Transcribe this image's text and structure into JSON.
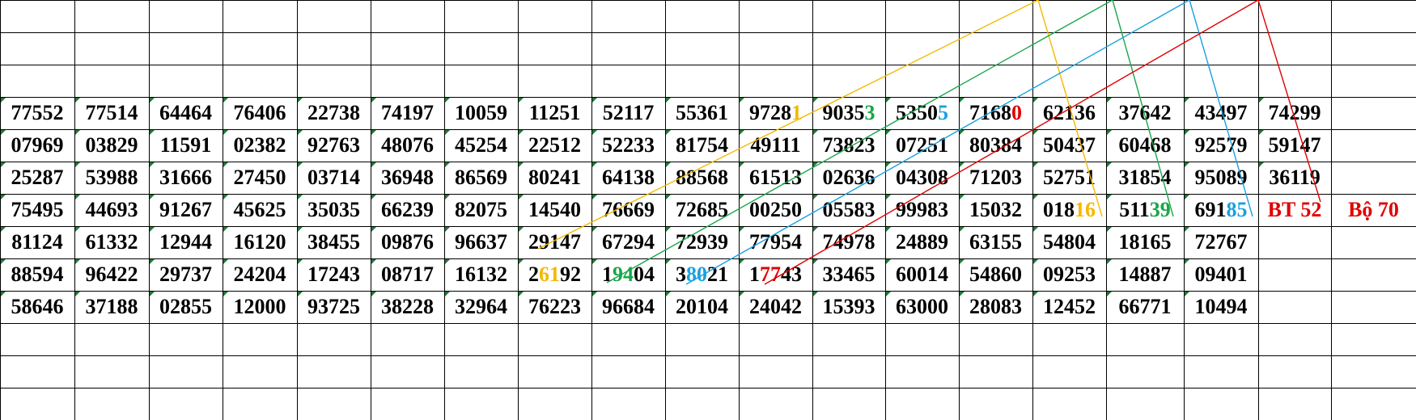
{
  "colors": {
    "gold": "#f5b800",
    "green": "#1aa64a",
    "blue": "#1aa0e0",
    "red": "#e00000",
    "black": "#000000",
    "grid": "#000000",
    "marker": "#1e7b34"
  },
  "rows": [
    [
      {
        "t": "77552"
      },
      {
        "t": "77514"
      },
      {
        "t": "64464"
      },
      {
        "t": "76406"
      },
      {
        "t": "22738"
      },
      {
        "t": "74197"
      },
      {
        "t": "10059"
      },
      {
        "t": "11251"
      },
      {
        "t": "52117"
      },
      {
        "t": "55361"
      },
      {
        "p": [
          {
            "t": "9728"
          },
          {
            "t": "1",
            "c": "gold"
          }
        ]
      },
      {
        "p": [
          {
            "t": "9035"
          },
          {
            "t": "3",
            "c": "green"
          }
        ]
      },
      {
        "p": [
          {
            "t": "5350"
          },
          {
            "t": "5",
            "c": "blue"
          }
        ]
      },
      {
        "p": [
          {
            "t": "7168"
          },
          {
            "t": "0",
            "c": "red"
          }
        ]
      },
      {
        "t": "62136"
      },
      {
        "t": "37642"
      },
      {
        "t": "43497"
      },
      {
        "t": "74299"
      }
    ],
    [
      {
        "t": "07969"
      },
      {
        "t": "03829"
      },
      {
        "t": "11591"
      },
      {
        "t": "02382"
      },
      {
        "t": "92763"
      },
      {
        "t": "48076"
      },
      {
        "t": "45254"
      },
      {
        "t": "22512"
      },
      {
        "t": "52233"
      },
      {
        "t": "81754"
      },
      {
        "t": "49111"
      },
      {
        "t": "73823"
      },
      {
        "t": "07251"
      },
      {
        "t": "80384"
      },
      {
        "t": "50437"
      },
      {
        "t": "60468"
      },
      {
        "t": "92579"
      },
      {
        "t": "59147"
      }
    ],
    [
      {
        "t": "25287"
      },
      {
        "t": "53988"
      },
      {
        "t": "31666"
      },
      {
        "t": "27450"
      },
      {
        "t": "03714"
      },
      {
        "t": "36948"
      },
      {
        "t": "86569"
      },
      {
        "t": "80241"
      },
      {
        "t": "64138"
      },
      {
        "t": "88568"
      },
      {
        "t": "61513"
      },
      {
        "t": "02636"
      },
      {
        "t": "04308"
      },
      {
        "t": "71203"
      },
      {
        "t": "52751"
      },
      {
        "t": "31854"
      },
      {
        "t": "95089"
      },
      {
        "t": "36119"
      }
    ],
    [
      {
        "t": "75495"
      },
      {
        "t": "44693"
      },
      {
        "t": "91267"
      },
      {
        "t": "45625"
      },
      {
        "t": "35035"
      },
      {
        "t": "66239"
      },
      {
        "t": "82075"
      },
      {
        "t": "14540"
      },
      {
        "t": "76669"
      },
      {
        "t": "72685"
      },
      {
        "t": "00250"
      },
      {
        "t": "05583"
      },
      {
        "t": "99983"
      },
      {
        "t": "15032"
      },
      {
        "p": [
          {
            "t": "018"
          },
          {
            "t": "16",
            "c": "gold"
          }
        ]
      },
      {
        "p": [
          {
            "t": "511"
          },
          {
            "t": "39",
            "c": "green"
          }
        ]
      },
      {
        "p": [
          {
            "t": "691"
          },
          {
            "t": "85",
            "c": "blue"
          }
        ]
      },
      {
        "p": [
          {
            "t": "BT 52",
            "c": "red"
          }
        ]
      },
      {
        "p": [
          {
            "t": "Bộ 70",
            "c": "red"
          }
        ]
      }
    ],
    [
      {
        "t": "81124"
      },
      {
        "t": "61332"
      },
      {
        "t": "12944"
      },
      {
        "t": "16120"
      },
      {
        "t": "38455"
      },
      {
        "t": "09876"
      },
      {
        "t": "96637"
      },
      {
        "t": "29147"
      },
      {
        "t": "67294"
      },
      {
        "t": "72939"
      },
      {
        "t": "77954"
      },
      {
        "t": "74978"
      },
      {
        "t": "24889"
      },
      {
        "t": "63155"
      },
      {
        "t": "54804"
      },
      {
        "t": "18165"
      },
      {
        "t": "72767"
      }
    ],
    [
      {
        "t": "88594"
      },
      {
        "t": "96422"
      },
      {
        "t": "29737"
      },
      {
        "t": "24204"
      },
      {
        "t": "17243"
      },
      {
        "t": "08717"
      },
      {
        "t": "16132"
      },
      {
        "p": [
          {
            "t": "2"
          },
          {
            "t": "61",
            "c": "gold"
          },
          {
            "t": "92"
          }
        ]
      },
      {
        "p": [
          {
            "t": "1"
          },
          {
            "t": "94",
            "c": "green"
          },
          {
            "t": "04"
          }
        ]
      },
      {
        "p": [
          {
            "t": "3"
          },
          {
            "t": "80",
            "c": "blue"
          },
          {
            "t": "21"
          }
        ]
      },
      {
        "p": [
          {
            "t": "1"
          },
          {
            "t": "77",
            "c": "red"
          },
          {
            "t": "43"
          }
        ]
      },
      {
        "t": "33465"
      },
      {
        "t": "60014"
      },
      {
        "t": "54860"
      },
      {
        "t": "09253"
      },
      {
        "t": "14887"
      },
      {
        "t": "09401"
      }
    ],
    [
      {
        "t": "58646"
      },
      {
        "t": "37188"
      },
      {
        "t": "02855"
      },
      {
        "t": "12000"
      },
      {
        "t": "93725"
      },
      {
        "t": "38228"
      },
      {
        "t": "32964"
      },
      {
        "t": "76223"
      },
      {
        "t": "96684"
      },
      {
        "t": "20104"
      },
      {
        "t": "24042"
      },
      {
        "t": "15393"
      },
      {
        "t": "63000"
      },
      {
        "t": "28083"
      },
      {
        "t": "12452"
      },
      {
        "t": "66771"
      },
      {
        "t": "10494"
      }
    ]
  ]
}
